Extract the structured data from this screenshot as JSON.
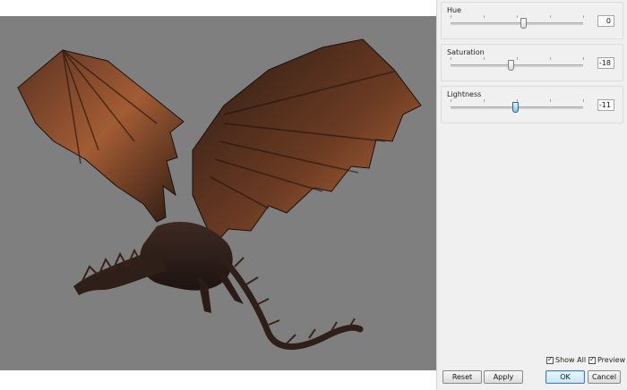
{
  "preview": {
    "image": "dragon-image"
  },
  "adjustments": [
    {
      "label": "Hue",
      "value": "0",
      "level_fraction": 0.5
    },
    {
      "label": "Saturation",
      "value": "-18",
      "level_fraction": 0.41
    },
    {
      "label": "Lightness",
      "value": "-11",
      "level_fraction": 0.445
    }
  ],
  "options": {
    "show_all_label": "Show All",
    "show_all_checked": true,
    "preview_label": "Preview",
    "preview_checked": true
  },
  "buttons": {
    "reset": "Reset",
    "apply": "Apply",
    "ok": "OK",
    "cancel": "Cancel"
  },
  "colors": {
    "canvas_bg": "#7f7f7f",
    "panel_bg": "#f0f0f0",
    "dragon": "#3a2318",
    "dragon_highlight": "#b56a3c"
  }
}
